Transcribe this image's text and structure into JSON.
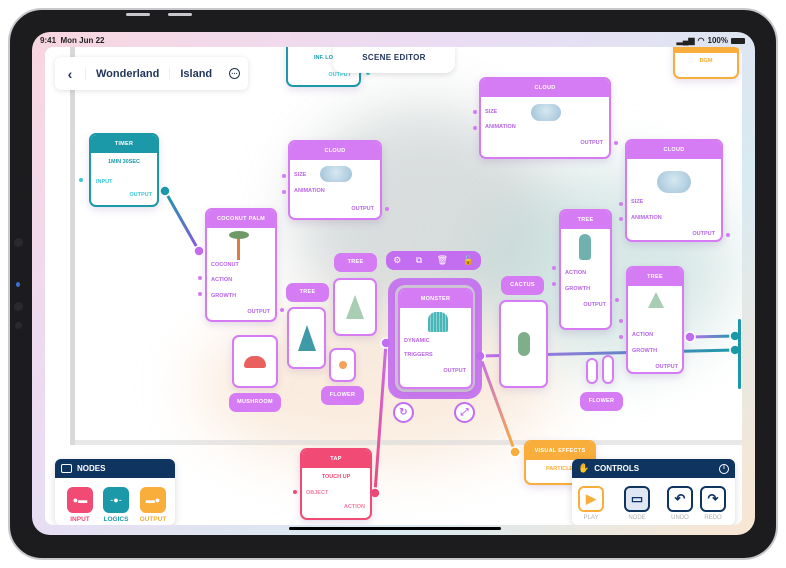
{
  "status_bar": {
    "time": "9:41",
    "date": "Mon Jun 22",
    "battery": "100%"
  },
  "breadcrumb": {
    "items": [
      "Wonderland",
      "Island"
    ]
  },
  "header": {
    "title": "SCENE EDITOR"
  },
  "colors": {
    "logic": "#d57cf5",
    "input": "#f04a75",
    "teal": "#1b99a8",
    "output": "#f9ad3a",
    "navy": "#0f3460"
  },
  "nodes": {
    "loop": {
      "subtitle": "INF. LOOP",
      "output": "OUTPUT"
    },
    "bgm": {
      "subtitle": "BGM"
    },
    "timer": {
      "title": "TIMER",
      "subtitle": "1MIN 30SEC",
      "input": "INPUT",
      "output": "OUTPUT"
    },
    "cloud1": {
      "title": "CLOUD",
      "size": "SIZE",
      "animation": "ANIMATION",
      "output": "OUTPUT"
    },
    "cloud2": {
      "title": "CLOUD",
      "size": "SIZE",
      "animation": "ANIMATION",
      "output": "OUTPUT"
    },
    "cloud3": {
      "title": "CLOUD",
      "size": "SIZE",
      "animation": "ANIMATION",
      "output": "OUTPUT"
    },
    "coconut": {
      "title": "COCONUT PALM",
      "coconut": "COCONUT",
      "action": "ACTION",
      "growth": "GROWTH",
      "output": "OUTPUT"
    },
    "monster": {
      "title": "MONSTER",
      "dynamic": "DYNAMIC",
      "triggers": "TRIGGERS",
      "output": "OUTPUT"
    },
    "tree1": {
      "title": "TREE",
      "action": "ACTION",
      "growth": "GROWTH",
      "output": "OUTPUT"
    },
    "tree2": {
      "title": "TREE",
      "action": "ACTION",
      "growth": "GROWTH",
      "output": "OUTPUT"
    },
    "tap": {
      "title": "TAP",
      "subtitle": "TOUCH UP",
      "object": "OBJECT",
      "action": "ACTION"
    },
    "visual": {
      "title": "VISUAL EFFECTS",
      "subtitle": "PARTICLES"
    }
  },
  "assets": {
    "tree_a": "TREE",
    "tree_b": "TREE",
    "mushroom": "MUSHROOM",
    "flower_a": "FLOWER",
    "cactus": "CACTUS",
    "flower_b": "FLOWER"
  },
  "nodes_panel": {
    "title": "NODES",
    "items": [
      "INPUT",
      "LOGICS",
      "OUTPUT"
    ]
  },
  "controls_panel": {
    "title": "CONTROLS",
    "items": [
      "PLAY",
      "NODE",
      "UNDO",
      "REDO"
    ]
  }
}
